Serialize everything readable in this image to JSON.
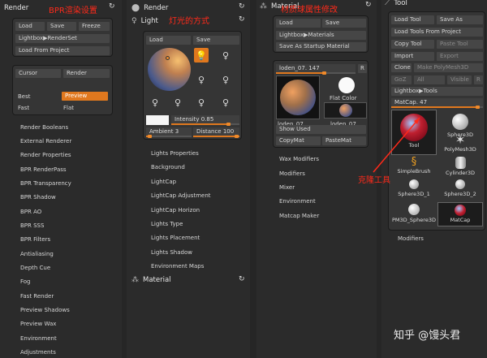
{
  "render": {
    "title": "Render",
    "note": "BPR渲染设置",
    "buttons": {
      "load": "Load",
      "save": "Save",
      "freeze": "Freeze",
      "lightbox": "Lightbox▶RenderSet",
      "load_project": "Load From Project"
    },
    "cursor": "Cursor",
    "render_btn": "Render",
    "best": "Best",
    "preview": "Preview",
    "fast": "Fast",
    "flat": "Flat",
    "items": [
      "Render Booleans",
      "External Renderer",
      "Render Properties",
      "BPR RenderPass",
      "BPR Transparency",
      "BPR Shadow",
      "BPR AO",
      "BPR SSS",
      "BPR Filters",
      "Antialiasing",
      "Depth Cue",
      "Fog",
      "Fast Render",
      "Preview Shadows",
      "Preview Wax",
      "Environment",
      "Adjustments"
    ]
  },
  "light": {
    "render_header": "Render",
    "title": "Light",
    "note": "灯光的方式",
    "load": "Load",
    "save": "Save",
    "intensity_label": "Intensity",
    "intensity": "0.85",
    "ambient_label": "Ambient",
    "ambient": "3",
    "distance_label": "Distance",
    "distance": "100",
    "items": [
      "Lights Properties",
      "Background",
      "LightCap",
      "LightCap Adjustment",
      "LightCap Horizon",
      "Lights Type",
      "Lights Placement",
      "Lights Shadow",
      "Environment Maps"
    ],
    "material_footer": "Material"
  },
  "material": {
    "title": "Material",
    "note": "材质球属性修改",
    "load": "Load",
    "save": "Save",
    "lightbox": "Lightbox▶Materials",
    "save_startup": "Save As Startup Material",
    "current_name": "loden_07.",
    "current_value": "147",
    "r_btn": "R",
    "flat_color": "Flat Color",
    "thumb_label": "loden_07",
    "thumb_label_2": "loden_07",
    "show_used": "Show Used",
    "copymat": "CopyMat",
    "pastemat": "PasteMat",
    "items": [
      "Wax Modifiers",
      "Modifiers",
      "Mixer",
      "Environment",
      "Matcap Maker"
    ]
  },
  "tool": {
    "title": "Tool",
    "load_tool": "Load Tool",
    "save_as": "Save As",
    "load_project": "Load Tools From Project",
    "copy_tool": "Copy Tool",
    "paste_tool": "Paste Tool",
    "import": "Import",
    "export": "Export",
    "clone": "Clone",
    "make_polymesh": "Make PolyMesh3D",
    "goz": "GoZ",
    "all": "All",
    "visible": "Visible",
    "r_btn": "R",
    "lightbox": "Lightbox▶Tools",
    "matcap_label": "MatCap.",
    "matcap_value": "47",
    "note": "克隆工具",
    "cells": [
      "Tool",
      "Sphere3D",
      "PolyMesh3D",
      "SimpleBrush",
      "Cylinder3D",
      "Sphere3D_1",
      "Sphere3D_2",
      "PM3D_Sphere3D",
      "MatCap"
    ],
    "modifiers": "Modifiers"
  },
  "watermark": "知乎 @馒头君",
  "colors": {
    "accent": "#e0781e",
    "annotation": "#ff2a1a"
  }
}
